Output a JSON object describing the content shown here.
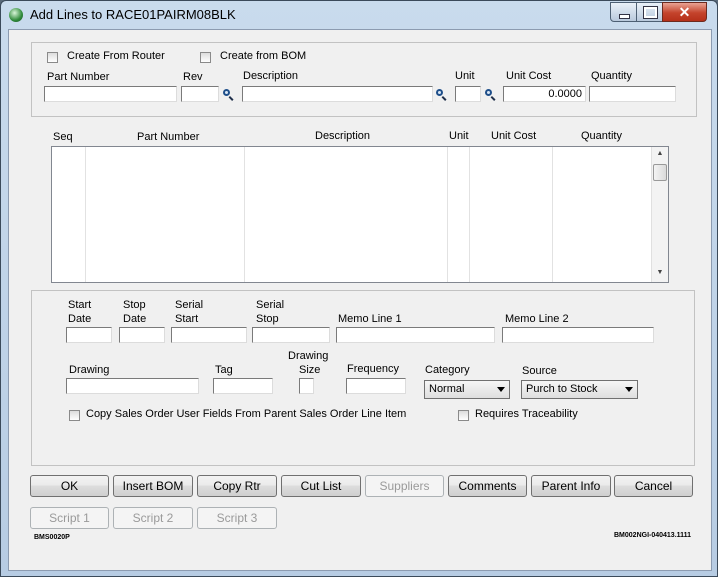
{
  "window": {
    "title": "Add Lines to RACE01PAIRM08BLK"
  },
  "router_bom": {
    "create_from_router": "Create From Router",
    "create_from_bom": "Create from BOM"
  },
  "entry": {
    "part_number_label": "Part Number",
    "rev_label": "Rev",
    "description_label": "Description",
    "unit_label": "Unit",
    "unit_cost_label": "Unit Cost",
    "quantity_label": "Quantity",
    "part_number_value": "",
    "rev_value": "",
    "description_value": "",
    "unit_value": "",
    "unit_cost_value": "0.0000",
    "quantity_value": ""
  },
  "grid": {
    "columns": [
      "Seq",
      "Part Number",
      "Description",
      "Unit",
      "Unit Cost",
      "Quantity"
    ],
    "rows": []
  },
  "details": {
    "start_date_label_1": "Start",
    "start_date_label_2": "Date",
    "stop_date_label_1": "Stop",
    "stop_date_label_2": "Date",
    "serial_start_label_1": "Serial",
    "serial_start_label_2": "Start",
    "serial_stop_label_1": "Serial",
    "serial_stop_label_2": "Stop",
    "memo1_label": "Memo Line 1",
    "memo2_label": "Memo Line 2",
    "drawing_label": "Drawing",
    "tag_label": "Tag",
    "drawing_size_label_1": "Drawing",
    "drawing_size_label_2": "Size",
    "frequency_label": "Frequency",
    "category_label": "Category",
    "category_value": "Normal",
    "source_label": "Source",
    "source_value": "Purch to Stock",
    "copy_sales_order": "Copy Sales Order User Fields From Parent Sales Order Line Item",
    "requires_traceability": "Requires Traceability"
  },
  "buttons": {
    "ok": "OK",
    "insert_bom": "Insert BOM",
    "copy_rtr": "Copy Rtr",
    "cut_list": "Cut List",
    "suppliers": "Suppliers",
    "comments": "Comments",
    "parent_info": "Parent Info",
    "cancel": "Cancel",
    "script1": "Script 1",
    "script2": "Script 2",
    "script3": "Script 3"
  },
  "footer": {
    "form_id": "BMS0020P",
    "version": "BM002NGI-040413.1111"
  },
  "colors": {
    "title_bar": "#b9cde4",
    "close_button": "#c4432b"
  },
  "icons": [
    "app-icon",
    "search-icon",
    "minimize-icon",
    "maximize-icon",
    "close-icon"
  ]
}
